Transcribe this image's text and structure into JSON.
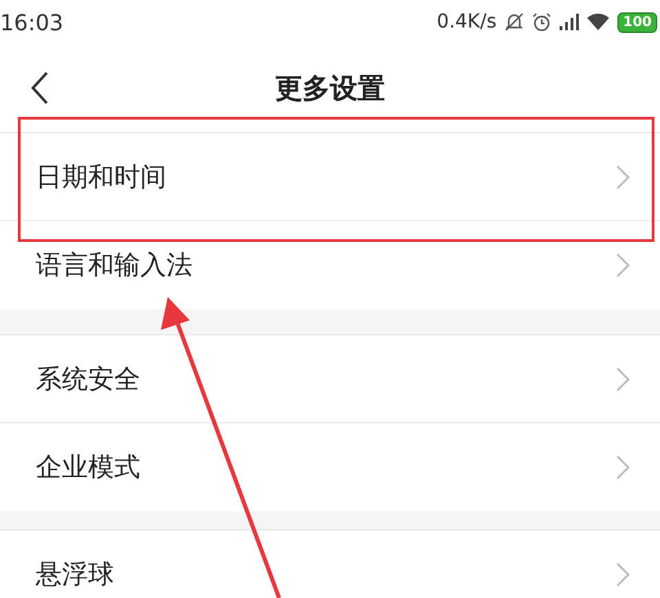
{
  "status_bar": {
    "time": "16:03",
    "net_speed": "0.4K/s",
    "battery": "100"
  },
  "header": {
    "title": "更多设置"
  },
  "groups": [
    {
      "items": [
        {
          "label": "日期和时间",
          "highlighted": true
        },
        {
          "label": "语言和输入法",
          "highlighted": false
        }
      ]
    },
    {
      "items": [
        {
          "label": "系统安全",
          "highlighted": false
        },
        {
          "label": "企业模式",
          "highlighted": false
        }
      ]
    },
    {
      "items": [
        {
          "label": "悬浮球",
          "highlighted": false
        }
      ]
    }
  ]
}
